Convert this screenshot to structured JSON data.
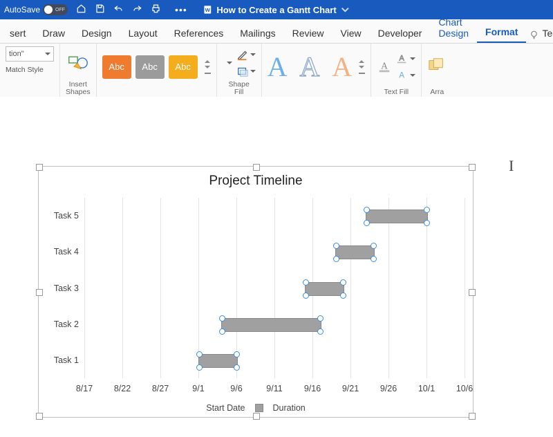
{
  "titlebar": {
    "autosave_label": "AutoSave",
    "autosave_state": "OFF",
    "doc_title": "How to Create a Gantt Chart"
  },
  "tabs": {
    "items": [
      "sert",
      "Draw",
      "Design",
      "Layout",
      "References",
      "Mailings",
      "Review",
      "View",
      "Developer",
      "Chart Design",
      "Format"
    ],
    "tell_me": "Tel"
  },
  "ribbon": {
    "seltext": "tion\"",
    "match_style": "Match Style",
    "insert_shapes": "Insert\nShapes",
    "swatch_text": "Abc",
    "shape_fill": "Shape\nFill",
    "text_fill": "Text Fill",
    "arrange": "Arra"
  },
  "chart_data": {
    "type": "bar",
    "orientation": "horizontal-stacked",
    "title": "Project Timeline",
    "categories": [
      "Task 5",
      "Task 4",
      "Task 3",
      "Task 2",
      "Task 1"
    ],
    "x_ticks": [
      "8/17",
      "8/22",
      "8/27",
      "9/1",
      "9/6",
      "9/11",
      "9/16",
      "9/21",
      "9/26",
      "10/1",
      "10/6"
    ],
    "x_range_days": [
      0,
      50
    ],
    "series": [
      {
        "name": "Start Date",
        "visible": false,
        "values_days_from_8_17": [
          37,
          33,
          29,
          18,
          15
        ]
      },
      {
        "name": "Duration",
        "visible": true,
        "values_days": [
          8,
          5,
          5,
          13,
          5
        ]
      }
    ],
    "tasks_readable": [
      {
        "task": "Task 1",
        "start": "9/1",
        "duration_days": 5
      },
      {
        "task": "Task 2",
        "start": "9/4",
        "duration_days": 13
      },
      {
        "task": "Task 3",
        "start": "9/15",
        "duration_days": 5
      },
      {
        "task": "Task 4",
        "start": "9/19",
        "duration_days": 5
      },
      {
        "task": "Task 5",
        "start": "9/23",
        "duration_days": 8
      }
    ],
    "legend": [
      "Start Date",
      "Duration"
    ],
    "selected_series": "Duration"
  }
}
